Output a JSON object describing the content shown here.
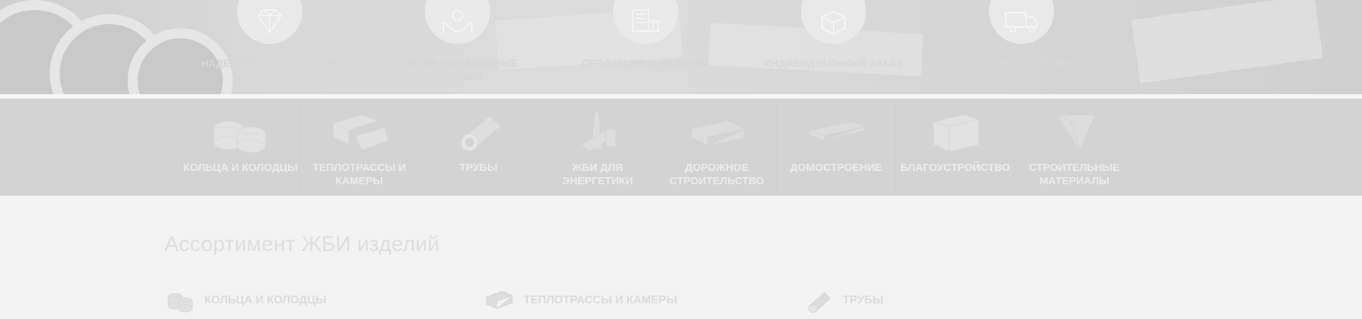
{
  "features": [
    {
      "label": "Надежная надежность",
      "icon": "diamond-icon"
    },
    {
      "label": "Гибкие финансовые условия",
      "icon": "hands-coin-icon"
    },
    {
      "label": "Продукция в наличии",
      "icon": "warehouse-icon"
    },
    {
      "label": "Индивидуальный заказ",
      "icon": "box-icon"
    },
    {
      "label": "Быстрая доставка",
      "icon": "truck-icon"
    }
  ],
  "categories": [
    {
      "label": "Кольца и колодцы",
      "icon": "rings-image"
    },
    {
      "label": "Теплотрассы и камеры",
      "icon": "trays-image"
    },
    {
      "label": "Трубы",
      "icon": "pipe-image"
    },
    {
      "label": "ЖБИ для энергетики",
      "icon": "energy-image"
    },
    {
      "label": "Дорожное строительство",
      "icon": "road-slab-image"
    },
    {
      "label": "Домостроение",
      "icon": "slab-image"
    },
    {
      "label": "Благоустройство",
      "icon": "landscape-image"
    },
    {
      "label": "Строительные материалы",
      "icon": "materials-image"
    }
  ],
  "assortment": {
    "title": "Ассортимент ЖБИ изделий",
    "items": [
      {
        "label": "Кольца и колодцы",
        "icon": "rings-thumb"
      },
      {
        "label": "Теплотрассы и камеры",
        "icon": "trays-thumb"
      },
      {
        "label": "Трубы",
        "icon": "pipe-thumb"
      }
    ]
  }
}
